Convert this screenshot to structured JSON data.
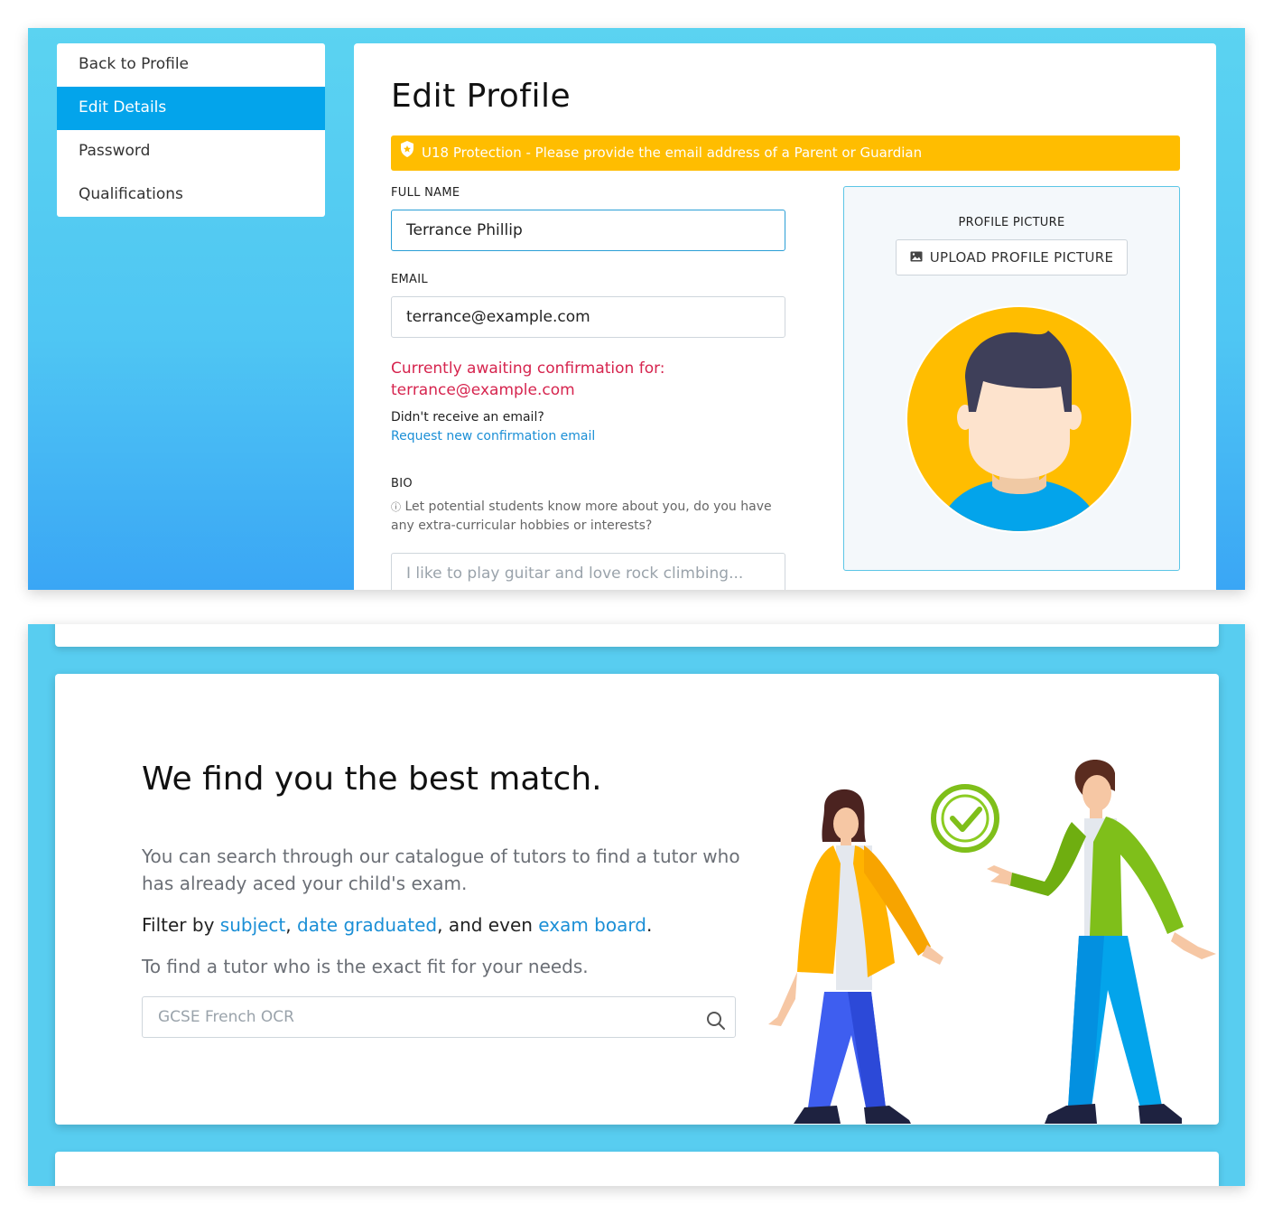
{
  "sidebar": {
    "items": [
      {
        "label": "Back to Profile",
        "active": false
      },
      {
        "label": "Edit Details",
        "active": true
      },
      {
        "label": "Password",
        "active": false
      },
      {
        "label": "Qualifications",
        "active": false
      }
    ]
  },
  "edit_profile": {
    "title": "Edit Profile",
    "alert": "U18 Protection - Please provide the email address of a Parent or Guardian",
    "full_name_label": "FULL NAME",
    "full_name_value": "Terrance Phillip",
    "email_label": "EMAIL",
    "email_value": "terrance@example.com",
    "awaiting_text": "Currently awaiting confirmation for:",
    "awaiting_email": "terrance@example.com",
    "no_email_text": "Didn't receive an email?",
    "request_link": "Request new confirmation email",
    "bio_label": "BIO",
    "bio_hint": "Let potential students know more about you, do you have any extra-curricular hobbies or interests?",
    "bio_placeholder": "I like to play guitar and love rock climbing...",
    "profile_picture_label": "PROFILE PICTURE",
    "upload_button": "UPLOAD PROFILE PICTURE"
  },
  "feature": {
    "title": "We find you the best match.",
    "paragraph1": "You can search through our catalogue of tutors to find a tutor who has already aced your child's exam.",
    "filter_prefix": "Filter by ",
    "filter_subject": "subject",
    "filter_sep1": ", ",
    "filter_date": "date graduated",
    "filter_sep2": ", and even ",
    "filter_board": "exam board",
    "filter_end": ".",
    "paragraph3": "To find a tutor who is the exact fit for your needs.",
    "search_placeholder": "GCSE French OCR"
  },
  "colors": {
    "accent": "#03a4eb",
    "warning": "#ffbd00",
    "error_text": "#d6244e",
    "link": "#1b8fd6"
  }
}
